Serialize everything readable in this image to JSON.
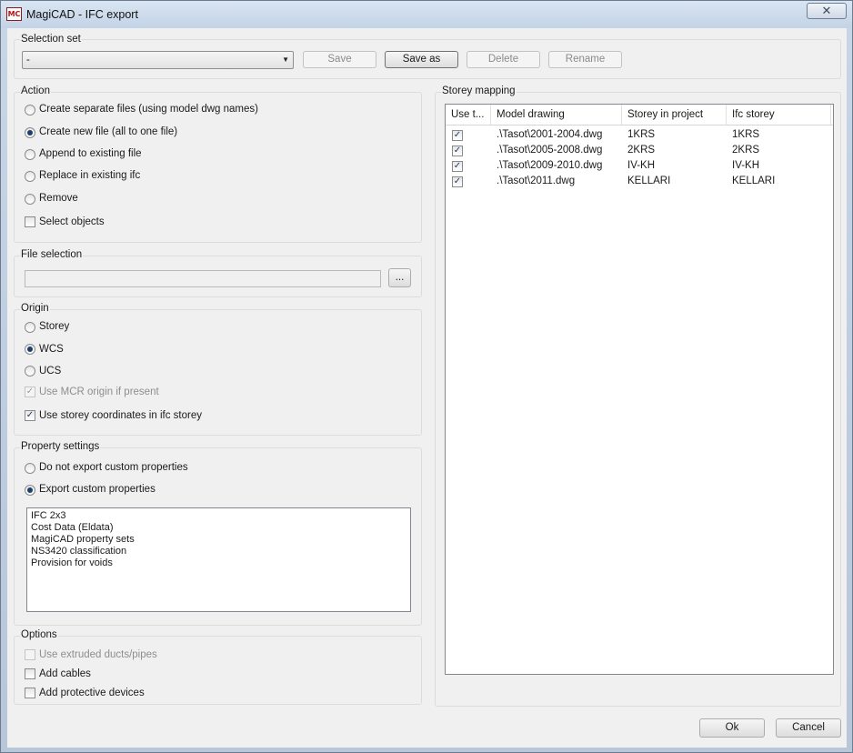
{
  "window": {
    "title": "MagiCAD - IFC export",
    "app_icon_text": "MC",
    "close_glyph": "✕"
  },
  "selection_set": {
    "label": "Selection set",
    "value": "-",
    "buttons": {
      "save": "Save",
      "save_as": "Save as",
      "delete": "Delete",
      "rename": "Rename"
    }
  },
  "action": {
    "label": "Action",
    "options": [
      {
        "label": "Create separate files (using model dwg names)",
        "checked": false
      },
      {
        "label": "Create new file (all to one file)",
        "checked": true
      },
      {
        "label": "Append to existing file",
        "checked": false
      },
      {
        "label": "Replace in existing ifc",
        "checked": false
      },
      {
        "label": "Remove",
        "checked": false
      }
    ],
    "select_objects": {
      "label": "Select objects",
      "checked": false
    }
  },
  "file_selection": {
    "label": "File selection",
    "value": "",
    "browse_label": "..."
  },
  "origin": {
    "label": "Origin",
    "options": [
      {
        "label": "Storey",
        "checked": false
      },
      {
        "label": "WCS",
        "checked": true
      },
      {
        "label": "UCS",
        "checked": false
      }
    ],
    "use_mcr_origin": {
      "label": "Use MCR origin if present",
      "checked": true,
      "enabled": false
    },
    "use_storey_coords": {
      "label": "Use storey coordinates in ifc storey",
      "checked": true
    }
  },
  "property_settings": {
    "label": "Property settings",
    "options": [
      {
        "label": "Do not export custom properties",
        "checked": false
      },
      {
        "label": "Export custom properties",
        "checked": true
      }
    ],
    "list": [
      "IFC 2x3",
      "Cost Data (Eldata)",
      "MagiCAD property sets",
      "NS3420 classification",
      "Provision for voids"
    ]
  },
  "options": {
    "label": "Options",
    "use_extruded": {
      "label": "Use extruded ducts/pipes",
      "checked": false,
      "enabled": false
    },
    "add_cables": {
      "label": "Add cables",
      "checked": false
    },
    "add_protective": {
      "label": "Add protective devices",
      "checked": false
    }
  },
  "storey_mapping": {
    "label": "Storey mapping",
    "columns": [
      "Use t...",
      "Model drawing",
      "Storey in project",
      "Ifc storey"
    ],
    "rows": [
      {
        "use": true,
        "drawing": ".\\Tasot\\2001-2004.dwg",
        "storey": "1KRS",
        "ifc": "1KRS"
      },
      {
        "use": true,
        "drawing": ".\\Tasot\\2005-2008.dwg",
        "storey": "2KRS",
        "ifc": "2KRS"
      },
      {
        "use": true,
        "drawing": ".\\Tasot\\2009-2010.dwg",
        "storey": "IV-KH",
        "ifc": "IV-KH"
      },
      {
        "use": true,
        "drawing": ".\\Tasot\\2011.dwg",
        "storey": "KELLARI",
        "ifc": "KELLARI"
      }
    ]
  },
  "footer": {
    "ok": "Ok",
    "cancel": "Cancel"
  },
  "glyphs": {
    "check": "✓",
    "combo_arrow": "▼"
  }
}
